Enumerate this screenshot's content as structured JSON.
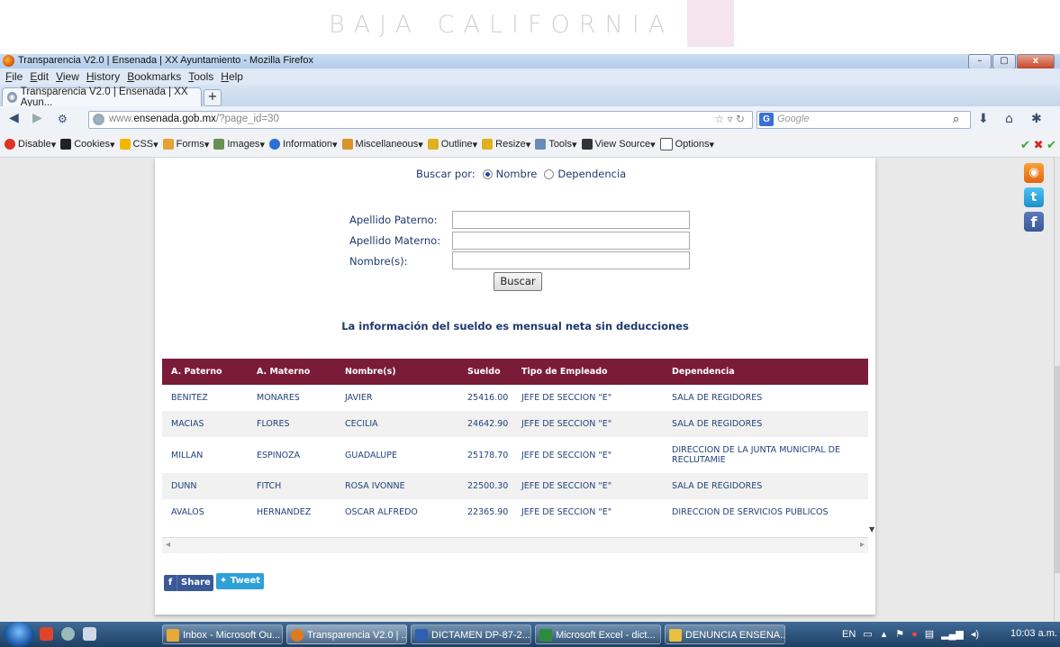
{
  "banner": {
    "text": "BAJA CALIFORNIA"
  },
  "window": {
    "title": "Transparencia V2.0 | Ensenada | XX Ayuntamiento - Mozilla Firefox",
    "controls": {
      "minimize": "–",
      "maximize": "▢",
      "close": "x"
    }
  },
  "menu": [
    "File",
    "Edit",
    "View",
    "History",
    "Bookmarks",
    "Tools",
    "Help"
  ],
  "tab": {
    "label": "Transparencia V2.0 | Ensenada | XX Ayun...",
    "new_tab": "+"
  },
  "nav": {
    "url_prefix": "www.",
    "url_domain": "ensenada.gob.mx",
    "url_path": "/?page_id=30",
    "search_placeholder": "Google",
    "search_engine": "G"
  },
  "devtoolbar": [
    "Disable",
    "Cookies",
    "CSS",
    "Forms",
    "Images",
    "Information",
    "Miscellaneous",
    "Outline",
    "Resize",
    "Tools",
    "View Source",
    "Options"
  ],
  "form": {
    "buscar_por_label": "Buscar por:",
    "option_nombre": "Nombre",
    "option_dependencia": "Dependencia",
    "selected": "Nombre",
    "apellido_paterno_label": "Apellido Paterno:",
    "apellido_materno_label": "Apellido Materno:",
    "nombres_label": "Nombre(s):",
    "apellido_paterno_value": "",
    "apellido_materno_value": "",
    "nombres_value": "",
    "submit_label": "Buscar"
  },
  "info_note": "La información del sueldo es mensual neta sin deducciones",
  "table": {
    "headers": [
      "A. Paterno",
      "A. Materno",
      "Nombre(s)",
      "Sueldo",
      "Tipo de Empleado",
      "Dependencia"
    ],
    "rows": [
      [
        "BENITEZ",
        "MONARES",
        "JAVIER",
        "25416.00",
        "JEFE DE SECCION \"E\"",
        "SALA DE REGIDORES"
      ],
      [
        "MACIAS",
        "FLORES",
        "CECILIA",
        "24642.90",
        "JEFE DE SECCION \"E\"",
        "SALA DE REGIDORES"
      ],
      [
        "MILLAN",
        "ESPINOZA",
        "GUADALUPE",
        "25178.70",
        "JEFE DE SECCION \"E\"",
        "DIRECCION DE LA JUNTA MUNICIPAL DE RECLUTAMIE"
      ],
      [
        "DUNN",
        "FITCH",
        "ROSA IVONNE",
        "22500.30",
        "JEFE DE SECCION \"E\"",
        "SALA DE REGIDORES"
      ],
      [
        "AVALOS",
        "HERNANDEZ",
        "OSCAR ALFREDO",
        "22365.90",
        "JEFE DE SECCION \"E\"",
        "DIRECCION DE SERVICIOS PUBLICOS"
      ]
    ]
  },
  "share": {
    "facebook_label": "Share",
    "twitter_label": "Tweet"
  },
  "taskbar": {
    "buttons": [
      "Inbox - Microsoft Ou...",
      "Transparencia V2.0 | ...",
      "DICTAMEN DP-87-2...",
      "Microsoft Excel - dict...",
      "DENUNCIA ENSENA..."
    ],
    "language": "EN",
    "clock": "10:03 a.m."
  }
}
